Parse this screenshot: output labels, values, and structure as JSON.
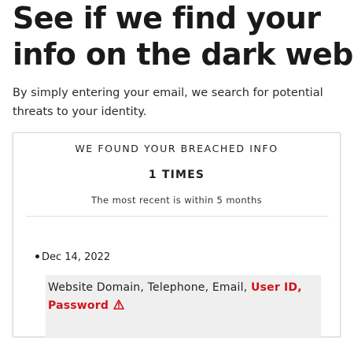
{
  "headline": {
    "line1": "See if we find your",
    "line2": "info on the dark web"
  },
  "subtext": {
    "line1": "By simply entering your email, we search for potential",
    "line2": "threats to your identity."
  },
  "result_card": {
    "title": "WE FOUND YOUR BREACHED INFO",
    "count": "1 TIMES",
    "recent": "The most recent is within 5 months",
    "breach": {
      "date": "Dec 14, 2022",
      "exposed_plain": "Website Domain, Telephone, Email,",
      "exposed_sensitive_1": "User ID,",
      "exposed_sensitive_2": "Password",
      "warning_icon": "warning-triangle-icon"
    }
  },
  "colors": {
    "danger": "#d0141b",
    "text": "#1f1f1f",
    "highlight_bg": "#efefef"
  }
}
